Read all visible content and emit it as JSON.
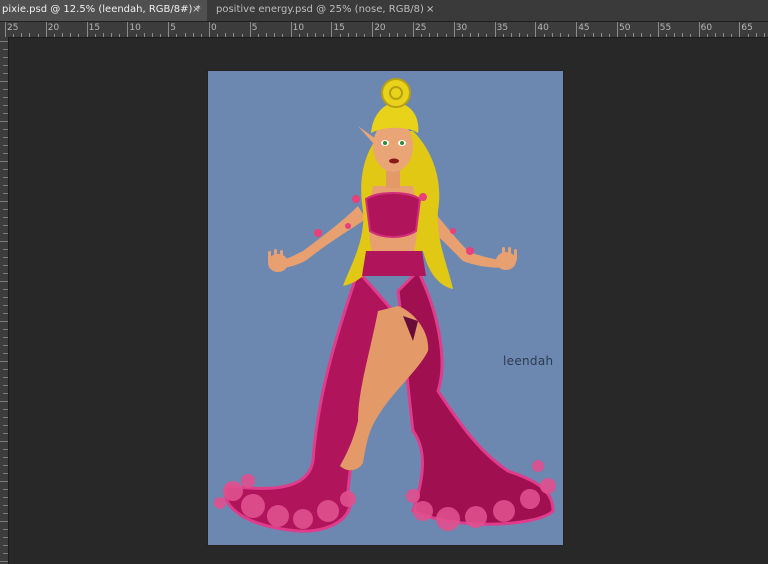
{
  "tabs": [
    {
      "label": "pixie.psd @ 12.5% (leendah, RGB/8#) *",
      "active": true
    },
    {
      "label": "positive energy.psd @ 25% (nose, RGB/8)",
      "active": false
    }
  ],
  "close_glyph": "×",
  "ruler_labels": [
    "25",
    "20",
    "15",
    "10",
    "5",
    "0",
    "5",
    "10",
    "15",
    "20",
    "25",
    "30",
    "35",
    "40",
    "45",
    "50",
    "55",
    "60",
    "65"
  ],
  "artwork": {
    "signature": "leendah",
    "colors": {
      "background": "#6d88b0",
      "dress": "#b0145a",
      "hair": "#e8d21a",
      "skin": "#e8a070",
      "flowers": "#e03c8c"
    }
  }
}
